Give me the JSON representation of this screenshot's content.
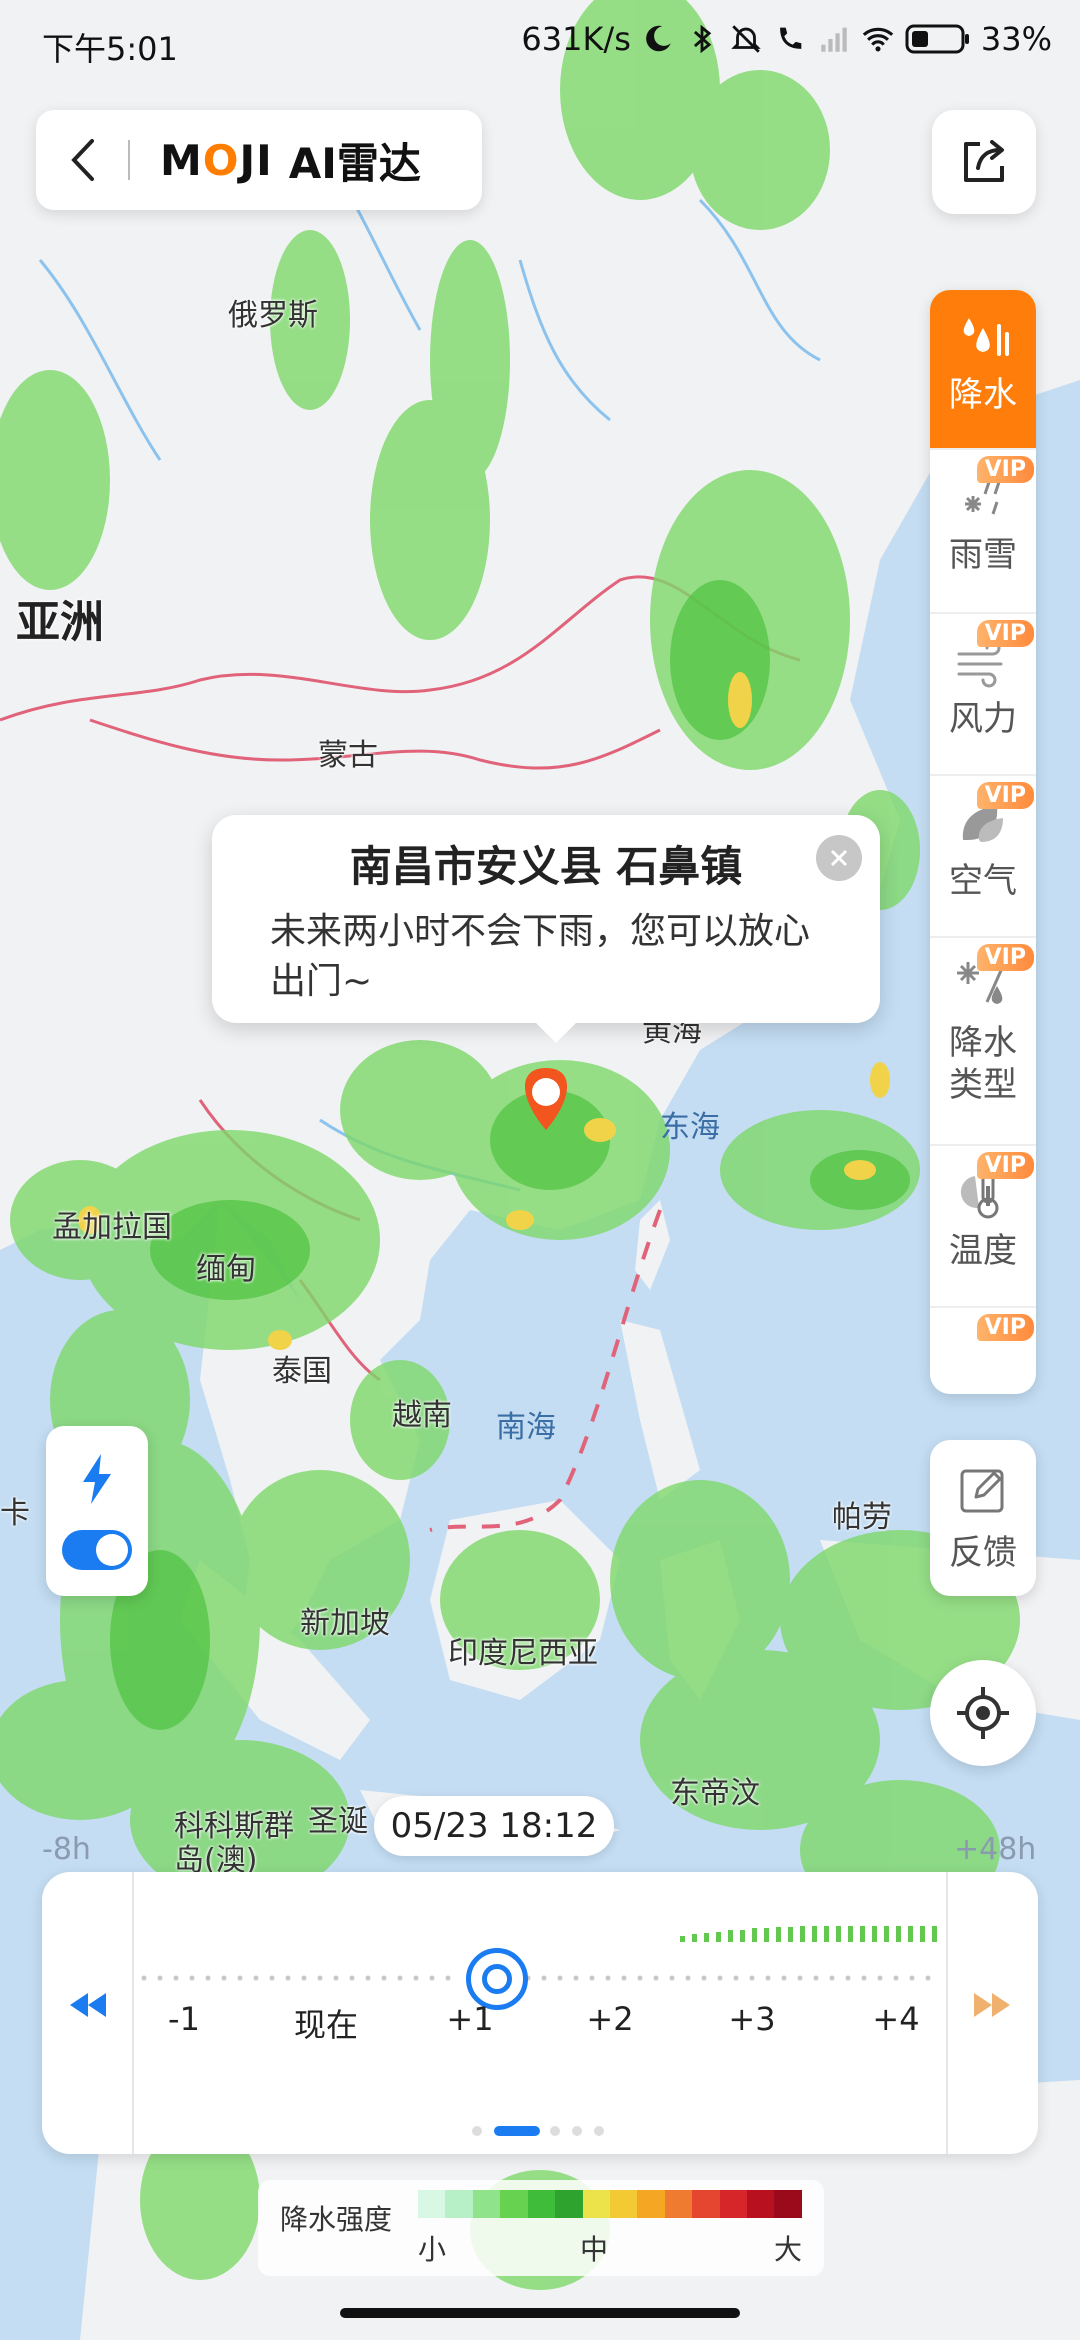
{
  "status_bar": {
    "time": "下午5:01",
    "network_speed": "631K/s",
    "battery": "33%"
  },
  "header": {
    "brand": "MOJI",
    "title": "AI雷达"
  },
  "map": {
    "labels": {
      "russia": "俄罗斯",
      "asia": "亚洲",
      "mongolia": "蒙古",
      "yellow_sea": "黄海",
      "east_sea": "东海",
      "bangladesh": "孟加拉国",
      "myanmar": "缅甸",
      "thailand": "泰国",
      "vietnam": "越南",
      "south_sea": "南海",
      "palau": "帕劳",
      "singapore": "新加坡",
      "indonesia": "印度尼西亚",
      "east_timor": "东帝汶",
      "cocos": "科科斯群岛(澳)",
      "christmas": "圣诞",
      "sri_lanka": "卡"
    }
  },
  "popup": {
    "title": "南昌市安义县  石鼻镇",
    "message": "未来两小时不会下雨，您可以放心出门~"
  },
  "layers": [
    {
      "label": "降水",
      "icon": "precipitation-icon",
      "vip": false,
      "active": true
    },
    {
      "label": "雨雪",
      "icon": "rain-snow-icon",
      "vip": true,
      "active": false
    },
    {
      "label": "风力",
      "icon": "wind-icon",
      "vip": true,
      "active": false
    },
    {
      "label": "空气",
      "icon": "air-quality-icon",
      "vip": true,
      "active": false
    },
    {
      "label": "降水\n类型",
      "icon": "precip-type-icon",
      "vip": true,
      "active": false
    },
    {
      "label": "温度",
      "icon": "temperature-icon",
      "vip": true,
      "active": false
    }
  ],
  "vip_badge": "VIP",
  "feedback_label": "反馈",
  "timeline": {
    "current_time": "05/23 18:12",
    "left_edge": "-8h",
    "right_edge": "+48h",
    "ticks": [
      "-1",
      "现在",
      "+1",
      "+2",
      "+3",
      "+4"
    ],
    "selected_tick": "+1"
  },
  "legend": {
    "title": "降水强度",
    "low": "小",
    "mid": "中",
    "high": "大",
    "colors": [
      "#d8f7e4",
      "#b7f0c6",
      "#8fe38a",
      "#66d24f",
      "#3fbd3a",
      "#2ea42e",
      "#ece24a",
      "#f3c934",
      "#f5a623",
      "#ee7b2f",
      "#e5462f",
      "#d6262a",
      "#b8101e",
      "#9a0a1a"
    ]
  },
  "colors": {
    "accent": "#ff7d0a",
    "primary_blue": "#1a7cf0",
    "sea": "#c9e2f5",
    "land": "#f2f3f5"
  }
}
